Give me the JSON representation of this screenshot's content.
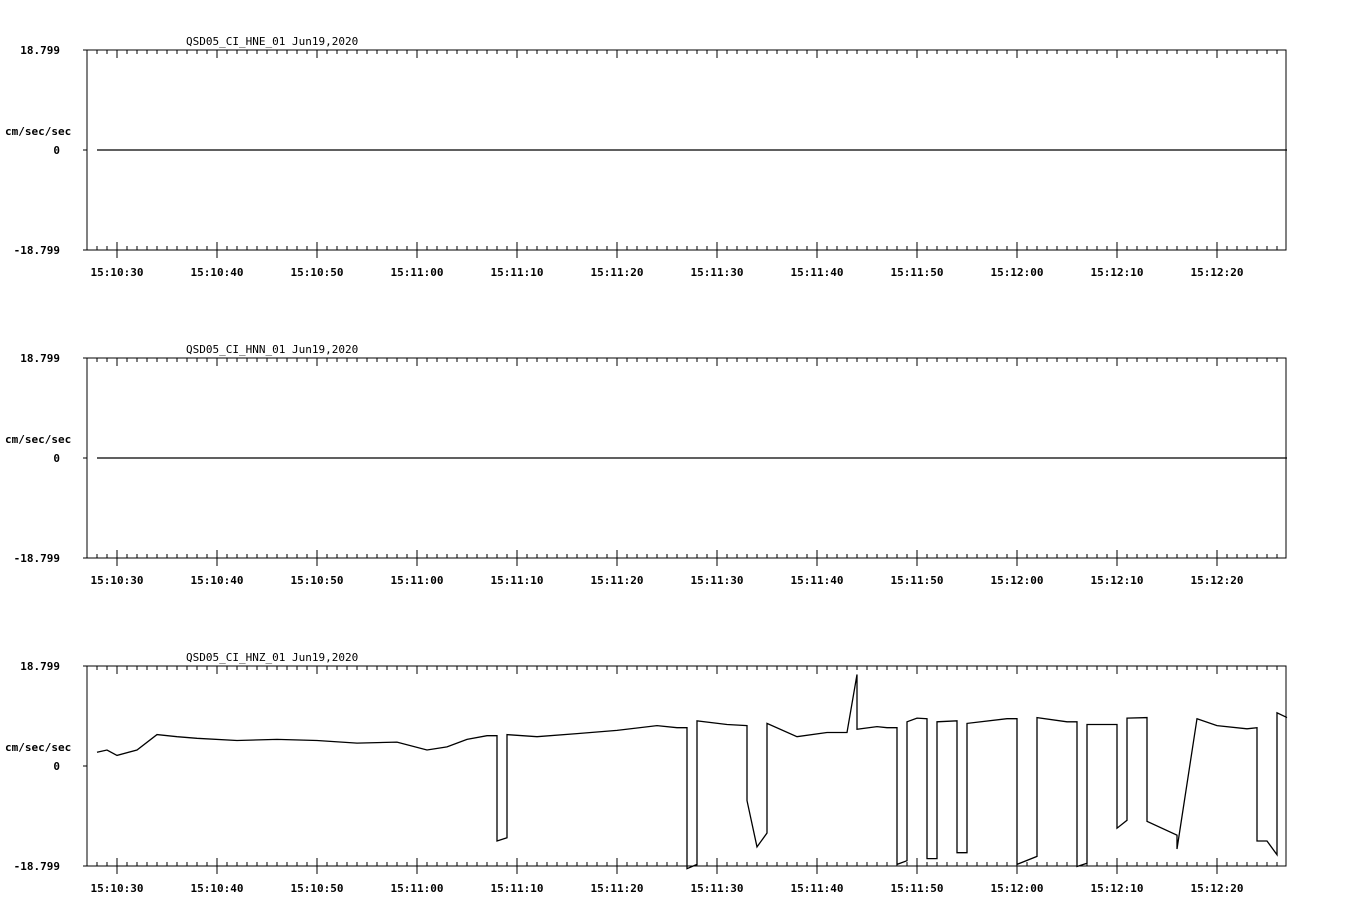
{
  "chart_data": [
    {
      "type": "line",
      "title": "QSD05_CI_HNE_01  Jun19,2020",
      "ylabel": "cm/sec/sec",
      "ylim": [
        -18.799,
        18.799
      ],
      "y_tick_labels": [
        "18.799",
        "0",
        "-18.799"
      ],
      "x_tick_labels": [
        "15:10:30",
        "15:10:40",
        "15:10:50",
        "15:11:00",
        "15:11:10",
        "15:11:20",
        "15:11:30",
        "15:11:40",
        "15:11:50",
        "15:12:00",
        "15:12:10",
        "15:12:20"
      ],
      "series": [
        {
          "x": [
            "15:10:28",
            "15:12:27"
          ],
          "y": [
            0,
            0
          ]
        }
      ]
    },
    {
      "type": "line",
      "title": "QSD05_CI_HNN_01  Jun19,2020",
      "ylabel": "cm/sec/sec",
      "ylim": [
        -18.799,
        18.799
      ],
      "y_tick_labels": [
        "18.799",
        "0",
        "-18.799"
      ],
      "x_tick_labels": [
        "15:10:30",
        "15:10:40",
        "15:10:50",
        "15:11:00",
        "15:11:10",
        "15:11:20",
        "15:11:30",
        "15:11:40",
        "15:11:50",
        "15:12:00",
        "15:12:10",
        "15:12:20"
      ],
      "series": [
        {
          "x": [
            "15:10:28",
            "15:12:27"
          ],
          "y": [
            0,
            0
          ]
        }
      ]
    },
    {
      "type": "line",
      "title": "QSD05_CI_HNZ_01  Jun19,2020",
      "ylabel": "cm/sec/sec",
      "ylim": [
        -18.799,
        18.799
      ],
      "y_tick_labels": [
        "18.799",
        "0",
        "-18.799"
      ],
      "x_tick_labels": [
        "15:10:30",
        "15:10:40",
        "15:10:50",
        "15:11:00",
        "15:11:10",
        "15:11:20",
        "15:11:30",
        "15:11:40",
        "15:11:50",
        "15:12:00",
        "15:12:10",
        "15:12:20"
      ],
      "series": [
        {
          "x": [
            "15:10:28",
            "15:10:29",
            "15:10:30",
            "15:10:32",
            "15:10:34",
            "15:10:36",
            "15:10:38",
            "15:10:42",
            "15:10:46",
            "15:10:50",
            "15:10:54",
            "15:10:58",
            "15:11:01",
            "15:11:03",
            "15:11:05",
            "15:11:07",
            "15:11:08",
            "15:11:08",
            "15:11:09",
            "15:11:09",
            "15:11:12",
            "15:11:16",
            "15:11:20",
            "15:11:24",
            "15:11:26",
            "15:11:27",
            "15:11:27",
            "15:11:28",
            "15:11:28",
            "15:11:31",
            "15:11:33",
            "15:11:33",
            "15:11:34",
            "15:11:35",
            "15:11:35",
            "15:11:38",
            "15:11:41",
            "15:11:43",
            "15:11:44",
            "15:11:44",
            "15:11:46",
            "15:11:47",
            "15:11:48",
            "15:11:48",
            "15:11:49",
            "15:11:49",
            "15:11:50",
            "15:11:51",
            "15:11:51",
            "15:11:52",
            "15:11:52",
            "15:11:54",
            "15:11:54",
            "15:11:55",
            "15:11:55",
            "15:11:59",
            "15:12:00",
            "15:12:00",
            "15:12:02",
            "15:12:02",
            "15:12:05",
            "15:12:06",
            "15:12:06",
            "15:12:07",
            "15:12:07",
            "15:12:09",
            "15:12:10",
            "15:12:10",
            "15:12:11",
            "15:12:11",
            "15:12:13",
            "15:12:13",
            "15:12:16",
            "15:12:16",
            "15:12:18",
            "15:12:20",
            "15:12:23",
            "15:12:24",
            "15:12:24",
            "15:12:25",
            "15:12:26",
            "15:12:26",
            "15:12:27"
          ],
          "y": [
            2.6,
            3.0,
            2.0,
            3.0,
            5.9,
            5.5,
            5.2,
            4.8,
            5.0,
            4.8,
            4.3,
            4.5,
            3.0,
            3.6,
            5.0,
            5.7,
            5.7,
            -14.1,
            -13.5,
            5.9,
            5.5,
            6.1,
            6.7,
            7.6,
            7.2,
            7.2,
            -19.3,
            -18.5,
            8.5,
            7.8,
            7.6,
            -6.5,
            -15.2,
            -12.6,
            8.0,
            5.5,
            6.3,
            6.3,
            17.2,
            6.9,
            7.4,
            7.2,
            7.2,
            -18.5,
            -17.8,
            8.3,
            9.0,
            8.9,
            -17.4,
            -17.4,
            8.3,
            8.5,
            -16.3,
            -16.3,
            8.0,
            8.9,
            8.9,
            -18.5,
            -17.0,
            9.1,
            8.3,
            8.3,
            -18.9,
            -18.3,
            7.8,
            7.8,
            7.8,
            -11.7,
            -10.2,
            9.0,
            9.1,
            -10.4,
            -13.0,
            -15.6,
            8.9,
            7.6,
            7.0,
            7.2,
            -14.1,
            -14.1,
            -16.7,
            10.0,
            9.1
          ]
        }
      ]
    }
  ]
}
